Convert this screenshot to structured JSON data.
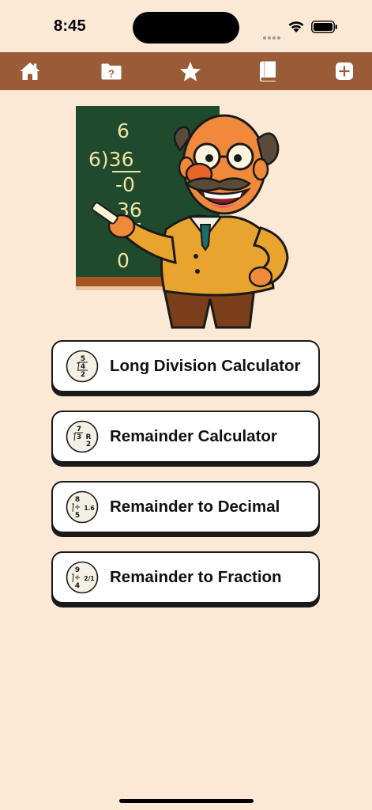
{
  "status_bar": {
    "time": "8:45"
  },
  "toolbar": {
    "items": [
      {
        "name": "home",
        "icon": "house-icon"
      },
      {
        "name": "help",
        "icon": "question-folder-icon"
      },
      {
        "name": "favorites",
        "icon": "star-icon"
      },
      {
        "name": "guide",
        "icon": "book-icon"
      },
      {
        "name": "add",
        "icon": "plus-square-icon"
      }
    ]
  },
  "hero": {
    "board": {
      "quotient": "6",
      "dividend": "6)36",
      "step1": "-0",
      "step2": "36",
      "remainder": "0"
    }
  },
  "menu": {
    "items": [
      {
        "label": "Long Division Calculator",
        "icon": {
          "a": "5",
          "b": "4",
          "c": "2",
          "side": ""
        }
      },
      {
        "label": "Remainder Calculator",
        "icon": {
          "a": "7",
          "b": "3",
          "c": "2",
          "side": "R"
        }
      },
      {
        "label": "Remainder to Decimal",
        "icon": {
          "a": "8",
          "b": "÷",
          "c": "5",
          "side": "1.6"
        }
      },
      {
        "label": "Remainder to Fraction",
        "icon": {
          "a": "9",
          "b": "÷",
          "c": "4",
          "side": "2/1"
        }
      }
    ]
  },
  "colors": {
    "background": "#FBE9D6",
    "toolbar": "#9A5C37",
    "chalkboard": "#1F4A2E",
    "chalk": "#F3E3A0"
  }
}
